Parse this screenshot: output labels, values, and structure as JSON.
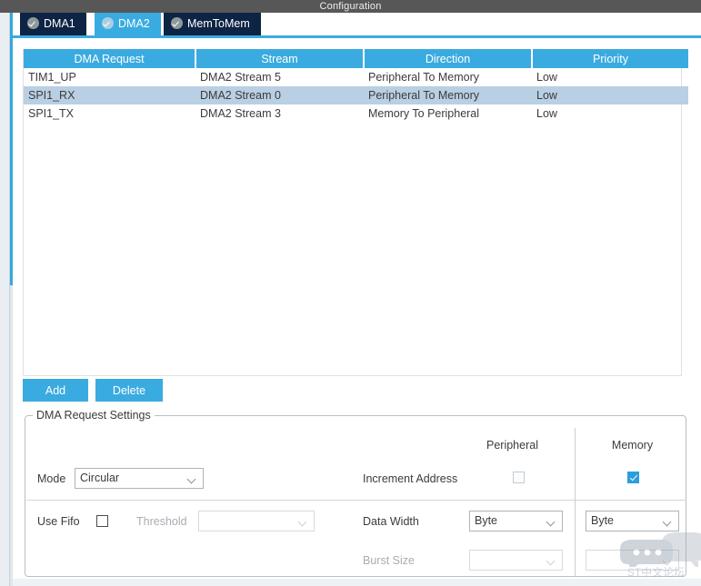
{
  "window": {
    "title": "Configuration"
  },
  "tabs": [
    {
      "label": "DMA1",
      "icon": "check-circle-icon",
      "active": false
    },
    {
      "label": "DMA2",
      "icon": "check-circle-icon",
      "active": true
    },
    {
      "label": "MemToMem",
      "icon": "check-circle-icon",
      "active": false
    }
  ],
  "table": {
    "columns": [
      "DMA Request",
      "Stream",
      "Direction",
      "Priority"
    ],
    "rows": [
      {
        "request": "TIM1_UP",
        "stream": "DMA2 Stream 5",
        "direction": "Peripheral To Memory",
        "priority": "Low",
        "selected": false
      },
      {
        "request": "SPI1_RX",
        "stream": "DMA2 Stream 0",
        "direction": "Peripheral To Memory",
        "priority": "Low",
        "selected": true
      },
      {
        "request": "SPI1_TX",
        "stream": "DMA2 Stream 3",
        "direction": "Memory To Peripheral",
        "priority": "Low",
        "selected": false
      }
    ]
  },
  "buttons": {
    "add": "Add",
    "delete": "Delete"
  },
  "settings": {
    "legend": "DMA Request Settings",
    "col_peripheral": "Peripheral",
    "col_memory": "Memory",
    "mode_label": "Mode",
    "mode_value": "Circular",
    "increment_label": "Increment Address",
    "increment_peripheral_checked": "false",
    "increment_memory_checked": "true",
    "use_fifo_label": "Use Fifo",
    "use_fifo_checked": "false",
    "threshold_label": "Threshold",
    "threshold_value": "",
    "data_width_label": "Data Width",
    "data_width_peripheral": "Byte",
    "data_width_memory": "Byte",
    "burst_size_label": "Burst Size",
    "burst_size_peripheral": "",
    "burst_size_memory": ""
  },
  "watermark": {
    "text": "ST中文论坛",
    "icon": "chat-bubble-icon"
  },
  "colors": {
    "accent": "#3aabe0",
    "tab_inactive": "#0d2444",
    "titlebar": "#575757",
    "row_selected": "#b9cfe3"
  }
}
